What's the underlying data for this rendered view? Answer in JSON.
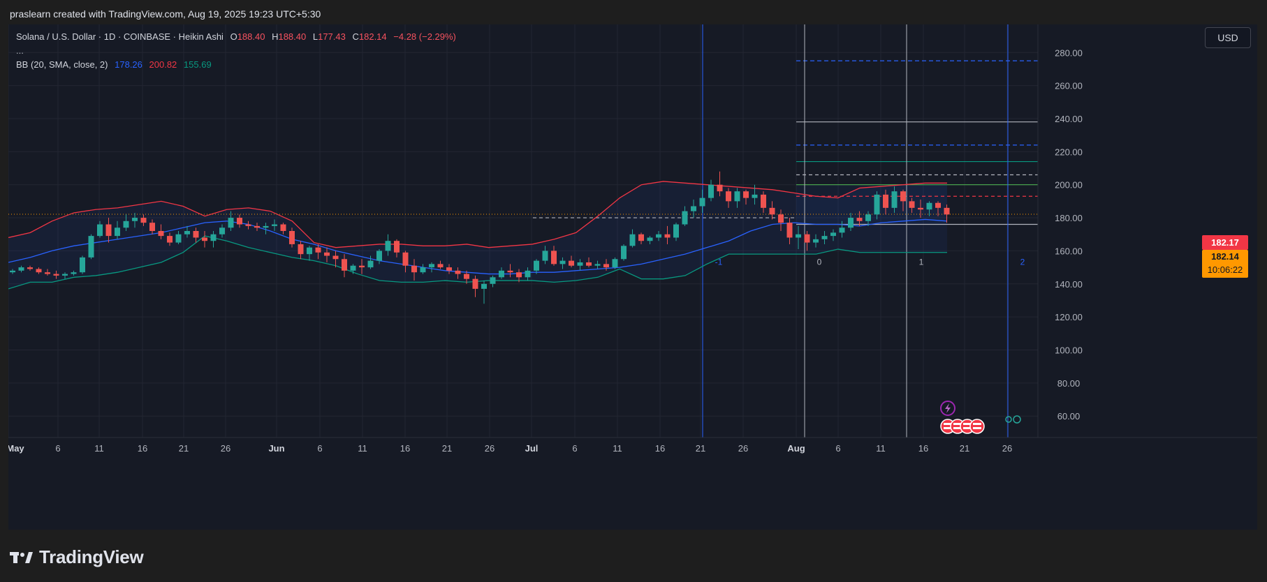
{
  "header": {
    "credit": "praslearn created with TradingView.com, Aug 19, 2025 19:23 UTC+5:30"
  },
  "legend": {
    "symbol": "Solana / U.S. Dollar · 1D · COINBASE · Heikin Ashi",
    "open_label": "O",
    "open": "188.40",
    "high_label": "H",
    "high": "188.40",
    "low_label": "L",
    "low": "177.43",
    "close_label": "C",
    "close": "182.14",
    "change": "−4.28 (−2.29%)",
    "more": "...",
    "bb_label": "BB (20, SMA, close, 2)",
    "bb_basis": "178.26",
    "bb_upper": "200.82",
    "bb_lower": "155.69"
  },
  "currency_button": "USD",
  "price_tags": {
    "upper": "182.17",
    "last": "182.14",
    "countdown": "10:06:22"
  },
  "footer": {
    "logo_text": "TradingView"
  },
  "colors": {
    "background": "#161a25",
    "up": "#26a69a",
    "down": "#ef5350",
    "bb_basis": "#2962ff",
    "bb_upper": "#f23645",
    "bb_lower": "#089981",
    "last_price": "#ff9800"
  },
  "chart_data": {
    "type": "candlestick",
    "title": "",
    "ylim": [
      47,
      297
    ],
    "y_ticks": [
      60,
      80,
      100,
      120,
      140,
      160,
      180,
      200,
      220,
      240,
      260,
      280
    ],
    "x_ticks": [
      "May",
      "6",
      "11",
      "16",
      "21",
      "26",
      "Jun",
      "6",
      "11",
      "16",
      "21",
      "26",
      "Jul",
      "6",
      "11",
      "16",
      "21",
      "26",
      "Aug",
      "6",
      "11",
      "16",
      "21",
      "26"
    ],
    "grid": true,
    "series": [
      {
        "name": "Heikin Ashi",
        "candles": [
          [
            147,
            149,
            146,
            148
          ],
          [
            148,
            151,
            147,
            150
          ],
          [
            150,
            151,
            148,
            149
          ],
          [
            149,
            150,
            146,
            147
          ],
          [
            147,
            149,
            145,
            146
          ],
          [
            146,
            148,
            143,
            145
          ],
          [
            145,
            147,
            143,
            146
          ],
          [
            146,
            148,
            145,
            147
          ],
          [
            147,
            157,
            146,
            156
          ],
          [
            156,
            170,
            155,
            169
          ],
          [
            169,
            178,
            168,
            176
          ],
          [
            176,
            180,
            165,
            169
          ],
          [
            169,
            178,
            167,
            174
          ],
          [
            174,
            182,
            172,
            178
          ],
          [
            178,
            183,
            174,
            180
          ],
          [
            180,
            182,
            175,
            177
          ],
          [
            177,
            179,
            170,
            172
          ],
          [
            172,
            176,
            167,
            169
          ],
          [
            169,
            171,
            163,
            165
          ],
          [
            165,
            172,
            164,
            170
          ],
          [
            170,
            175,
            168,
            172
          ],
          [
            172,
            174,
            165,
            168
          ],
          [
            168,
            172,
            162,
            166
          ],
          [
            166,
            172,
            162,
            170
          ],
          [
            170,
            176,
            168,
            174
          ],
          [
            174,
            184,
            172,
            180
          ],
          [
            180,
            182,
            174,
            176
          ],
          [
            176,
            178,
            173,
            175
          ],
          [
            175,
            177,
            172,
            174
          ],
          [
            174,
            177,
            170,
            175
          ],
          [
            175,
            179,
            172,
            176
          ],
          [
            176,
            177,
            170,
            172
          ],
          [
            172,
            174,
            162,
            164
          ],
          [
            164,
            166,
            155,
            158
          ],
          [
            158,
            163,
            154,
            162
          ],
          [
            162,
            164,
            155,
            159
          ],
          [
            159,
            162,
            153,
            157
          ],
          [
            157,
            160,
            150,
            155
          ],
          [
            155,
            158,
            144,
            148
          ],
          [
            148,
            152,
            146,
            151
          ],
          [
            151,
            155,
            146,
            150
          ],
          [
            150,
            157,
            149,
            154
          ],
          [
            154,
            161,
            152,
            160
          ],
          [
            160,
            170,
            157,
            166
          ],
          [
            166,
            167,
            156,
            159
          ],
          [
            159,
            160,
            147,
            151
          ],
          [
            151,
            155,
            142,
            147
          ],
          [
            147,
            152,
            146,
            150
          ],
          [
            150,
            153,
            147,
            152
          ],
          [
            152,
            154,
            149,
            150
          ],
          [
            150,
            152,
            146,
            148
          ],
          [
            148,
            150,
            143,
            146
          ],
          [
            146,
            148,
            140,
            143
          ],
          [
            143,
            145,
            132,
            137
          ],
          [
            137,
            142,
            128,
            140
          ],
          [
            140,
            145,
            138,
            144
          ],
          [
            144,
            150,
            143,
            148
          ],
          [
            148,
            152,
            144,
            147
          ],
          [
            147,
            149,
            141,
            144
          ],
          [
            144,
            150,
            142,
            148
          ],
          [
            148,
            155,
            146,
            154
          ],
          [
            154,
            163,
            152,
            160
          ],
          [
            160,
            163,
            151,
            152
          ],
          [
            152,
            156,
            149,
            154
          ],
          [
            154,
            157,
            150,
            151
          ],
          [
            151,
            155,
            148,
            153
          ],
          [
            153,
            156,
            150,
            151
          ],
          [
            151,
            154,
            149,
            152
          ],
          [
            152,
            155,
            148,
            150
          ],
          [
            150,
            156,
            149,
            155
          ],
          [
            155,
            164,
            154,
            163
          ],
          [
            163,
            173,
            162,
            170
          ],
          [
            170,
            171,
            164,
            166
          ],
          [
            166,
            169,
            164,
            168
          ],
          [
            168,
            172,
            166,
            170
          ],
          [
            170,
            175,
            164,
            168
          ],
          [
            168,
            177,
            166,
            176
          ],
          [
            176,
            187,
            175,
            184
          ],
          [
            184,
            191,
            180,
            187
          ],
          [
            187,
            197,
            183,
            192
          ],
          [
            192,
            203,
            190,
            200
          ],
          [
            200,
            208,
            193,
            196
          ],
          [
            196,
            198,
            186,
            190
          ],
          [
            190,
            198,
            186,
            196
          ],
          [
            196,
            197,
            188,
            192
          ],
          [
            192,
            200,
            188,
            194
          ],
          [
            194,
            196,
            183,
            186
          ],
          [
            186,
            190,
            179,
            182
          ],
          [
            182,
            185,
            172,
            177
          ],
          [
            177,
            180,
            164,
            168
          ],
          [
            168,
            175,
            161,
            170
          ],
          [
            170,
            172,
            160,
            165
          ],
          [
            165,
            170,
            162,
            167
          ],
          [
            167,
            172,
            164,
            169
          ],
          [
            169,
            173,
            166,
            171
          ],
          [
            171,
            178,
            168,
            174
          ],
          [
            174,
            183,
            172,
            180
          ],
          [
            180,
            184,
            175,
            178
          ],
          [
            178,
            184,
            175,
            182
          ],
          [
            182,
            196,
            179,
            194
          ],
          [
            194,
            197,
            182,
            186
          ],
          [
            186,
            199,
            183,
            196
          ],
          [
            196,
            197,
            184,
            190
          ],
          [
            190,
            192,
            183,
            186
          ],
          [
            186,
            191,
            180,
            185
          ],
          [
            185,
            190,
            181,
            189
          ],
          [
            189,
            190,
            181,
            186
          ],
          [
            186,
            188,
            177,
            182
          ]
        ]
      },
      {
        "name": "BB basis",
        "values": [
          153,
          156,
          160,
          163,
          165,
          167,
          169,
          171,
          174,
          177,
          178,
          176,
          172,
          167,
          164,
          160,
          157,
          154,
          152,
          150,
          148,
          147,
          146,
          146,
          147,
          147,
          148,
          149,
          150,
          152,
          155,
          158,
          162,
          166,
          172,
          176,
          177,
          176,
          176,
          175,
          177,
          178,
          179,
          178
        ]
      },
      {
        "name": "BB upper",
        "values": [
          168,
          171,
          178,
          183,
          185,
          186,
          188,
          190,
          187,
          181,
          185,
          186,
          184,
          178,
          165,
          162,
          163,
          164,
          164,
          163,
          163,
          164,
          162,
          163,
          164,
          167,
          171,
          181,
          192,
          200,
          202,
          201,
          200,
          199,
          198,
          197,
          195,
          193,
          192,
          198,
          199,
          200,
          201,
          201
        ]
      },
      {
        "name": "BB lower",
        "values": [
          137,
          141,
          141,
          144,
          145,
          147,
          150,
          153,
          159,
          169,
          166,
          162,
          159,
          156,
          154,
          151,
          146,
          142,
          141,
          141,
          142,
          141,
          142,
          142,
          142,
          141,
          142,
          144,
          149,
          143,
          143,
          145,
          152,
          158,
          158,
          158,
          158,
          158,
          161,
          159,
          159,
          159,
          159,
          159
        ]
      }
    ],
    "fibonacci_levels": [
      {
        "label": "-1",
        "value": 155
      },
      {
        "label": "0",
        "value": 155
      },
      {
        "label": "1",
        "value": 155
      },
      {
        "label": "2",
        "value": 155
      }
    ],
    "horizontal_levels": [
      275,
      238,
      224,
      214,
      206,
      200,
      193,
      176,
      180
    ],
    "last_price": 182.14
  }
}
